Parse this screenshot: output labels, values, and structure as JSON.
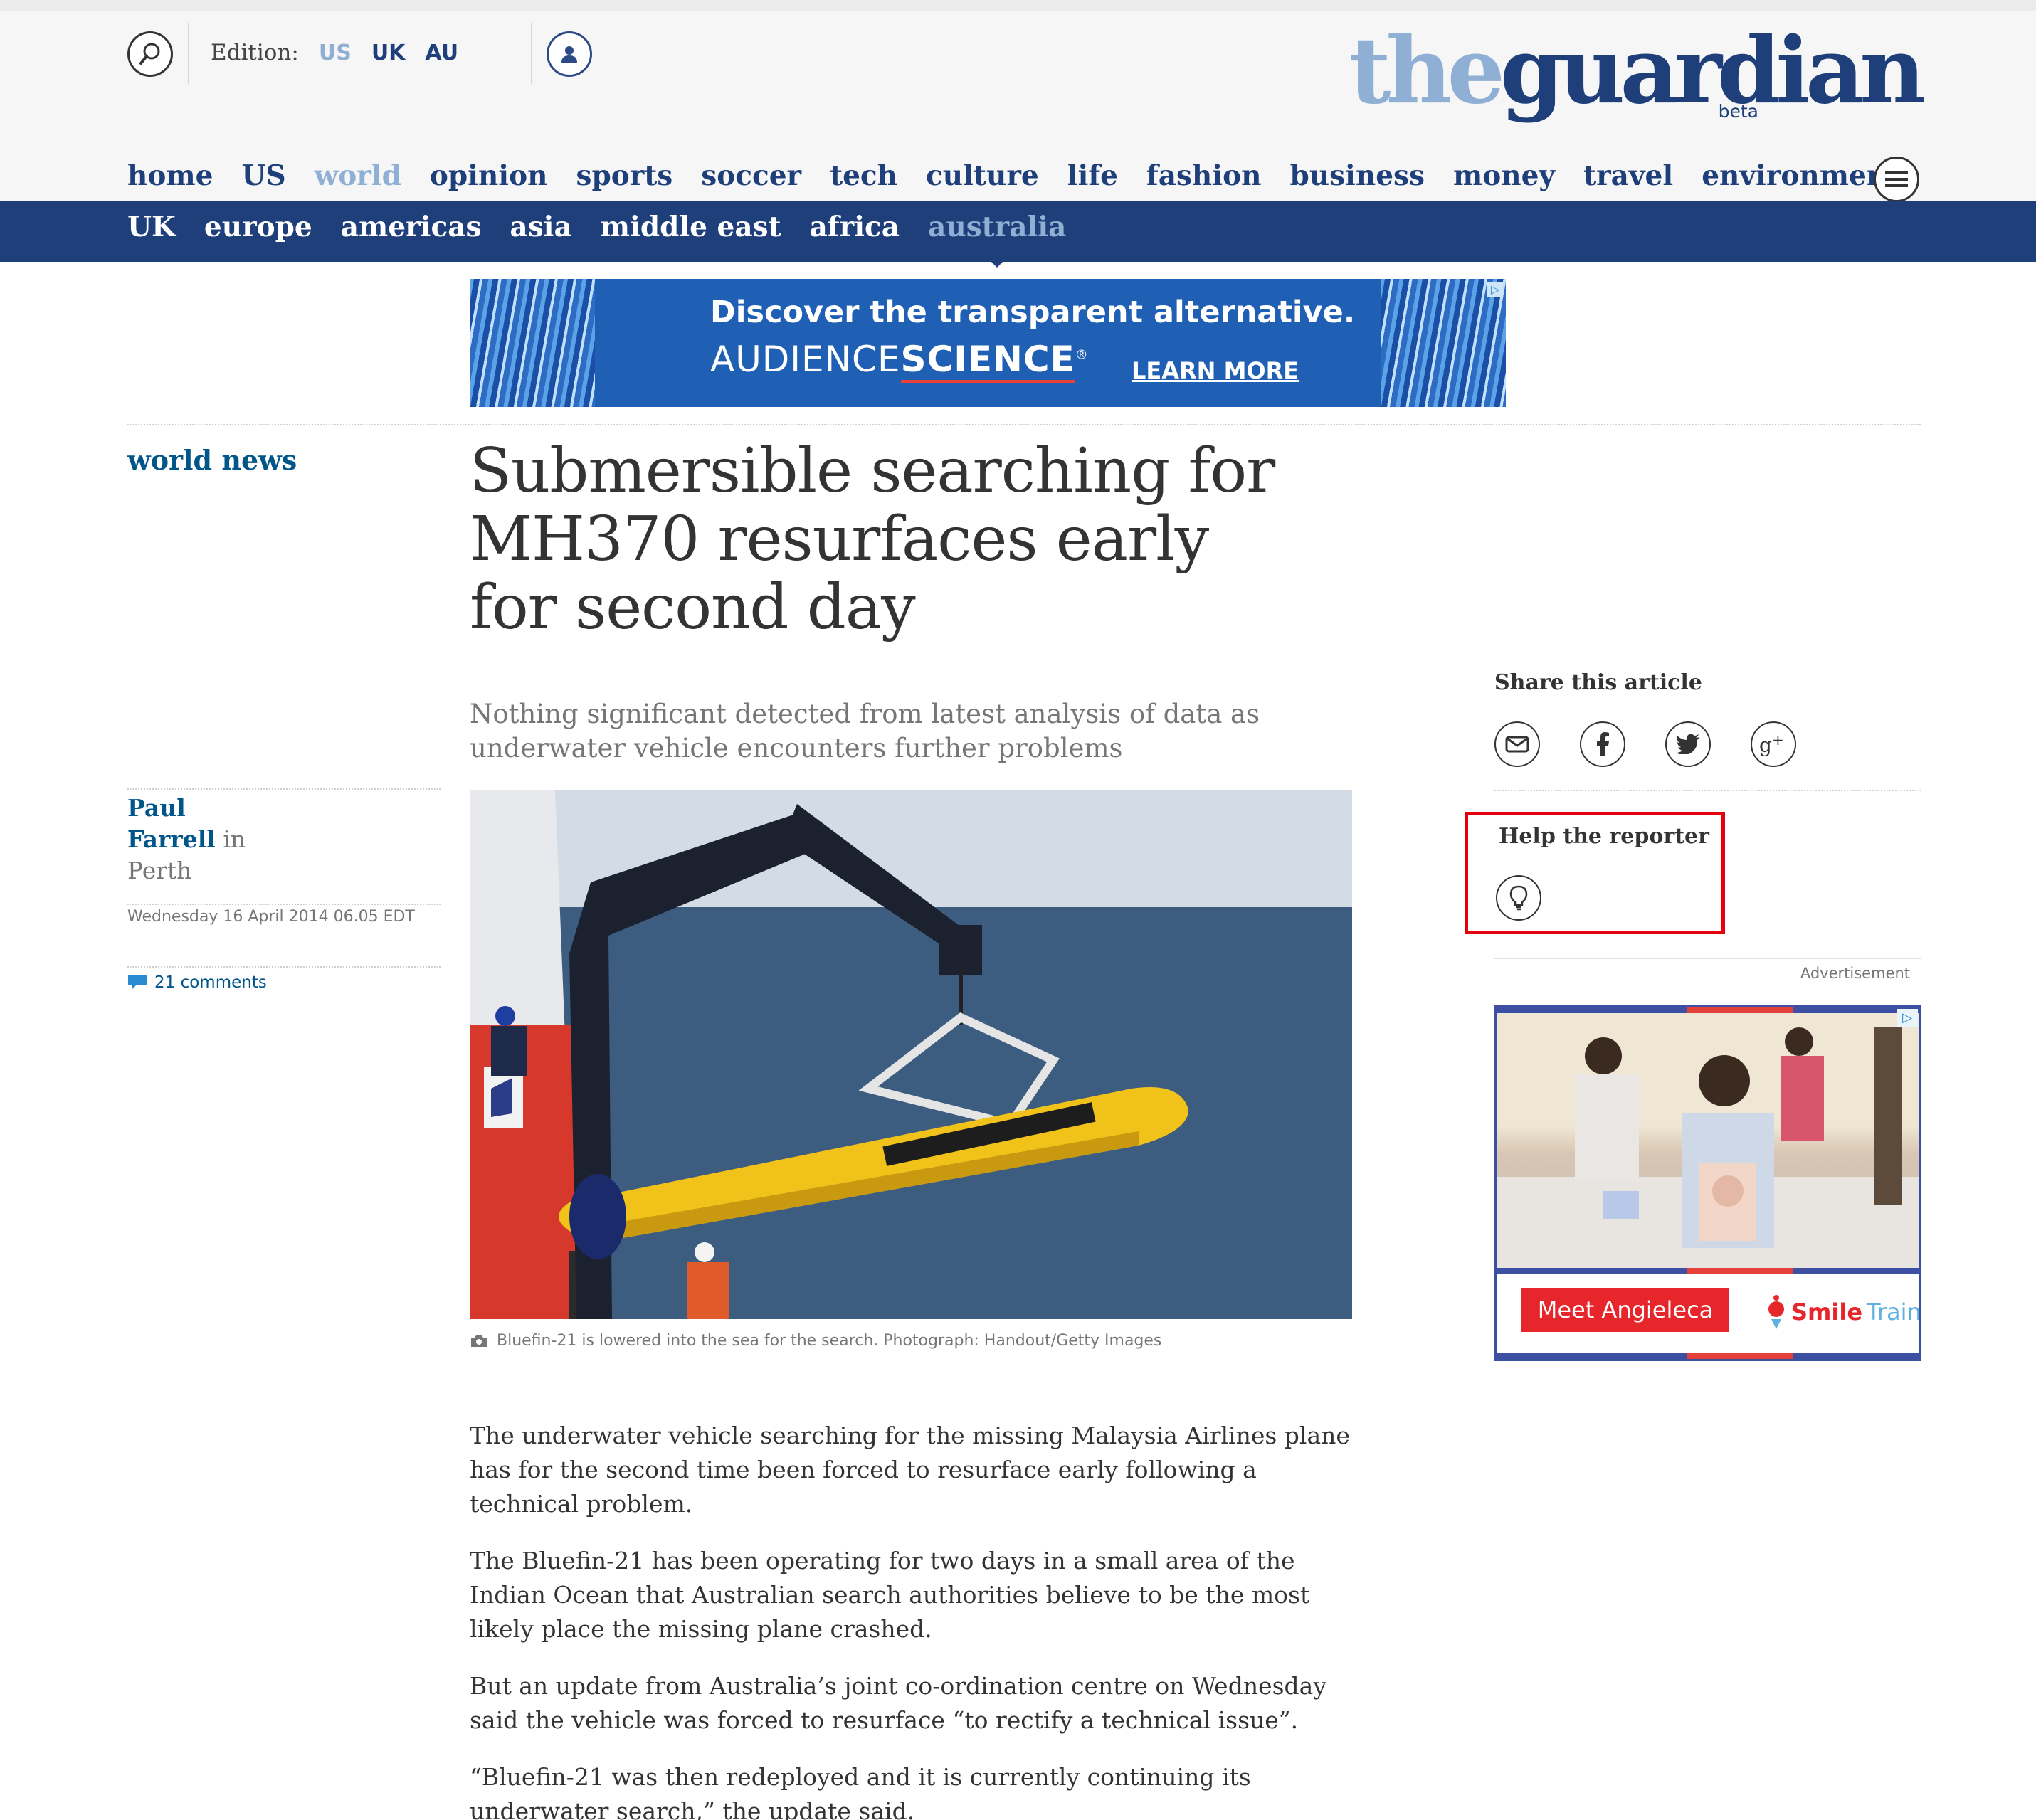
{
  "header": {
    "edition_label": "Edition:",
    "editions": [
      {
        "label": "US",
        "active": true
      },
      {
        "label": "UK",
        "active": false
      },
      {
        "label": "AU",
        "active": false
      }
    ],
    "logo_the": "the",
    "logo_guardian": "guardian",
    "logo_beta": "beta",
    "icons": [
      "search-icon",
      "profile-icon",
      "menu-icon"
    ]
  },
  "nav": {
    "items": [
      {
        "label": "home",
        "active": false
      },
      {
        "label": "US",
        "active": false
      },
      {
        "label": "world",
        "active": true
      },
      {
        "label": "opinion",
        "active": false
      },
      {
        "label": "sports",
        "active": false
      },
      {
        "label": "soccer",
        "active": false
      },
      {
        "label": "tech",
        "active": false
      },
      {
        "label": "culture",
        "active": false
      },
      {
        "label": "life",
        "active": false
      },
      {
        "label": "fashion",
        "active": false
      },
      {
        "label": "business",
        "active": false
      },
      {
        "label": "money",
        "active": false
      },
      {
        "label": "travel",
        "active": false
      },
      {
        "label": "environment",
        "active": false
      }
    ]
  },
  "subnav": {
    "items": [
      {
        "label": "UK",
        "active": false
      },
      {
        "label": "europe",
        "active": false
      },
      {
        "label": "americas",
        "active": false
      },
      {
        "label": "asia",
        "active": false
      },
      {
        "label": "middle east",
        "active": false
      },
      {
        "label": "africa",
        "active": false
      },
      {
        "label": "australia",
        "active": true
      }
    ]
  },
  "banner_ad": {
    "headline": "Discover the transparent alternative.",
    "brand_a": "AUDIENCE",
    "brand_b": "SCIENCE",
    "brand_mark": "®",
    "cta": "LEARN MORE"
  },
  "article": {
    "section": "world news",
    "headline": "Submersible searching for MH370 resurfaces early for second day",
    "standfirst": "Nothing significant detected from latest analysis of data as underwater vehicle encounters further problems",
    "author_first": "Paul",
    "author_last": "Farrell",
    "in": " in",
    "location": "Perth",
    "date": "Wednesday 16 April 2014 06.05 EDT",
    "comments": "21 comments",
    "caption": "Bluefin-21 is lowered into the sea for the search. Photograph: Handout/Getty Images",
    "paragraphs": [
      "The underwater vehicle searching for the missing Malaysia Airlines plane has for the second time been forced to resurface early following a technical problem.",
      "The Bluefin-21 has been operating for two days in a small area of the Indian Ocean that Australian search authorities believe to be the most likely place the missing plane crashed.",
      "But an update from Australia’s joint co-ordination centre on Wednesday said the vehicle was forced to resurface “to rectify a technical issue”.",
      "“Bluefin-21 was then redeployed and it is currently continuing its underwater search,” the update said."
    ]
  },
  "sidebar": {
    "share_title": "Share this article",
    "share_icons": [
      "email-icon",
      "facebook-icon",
      "twitter-icon",
      "google-plus-icon"
    ],
    "help_title": "Help the reporter",
    "help_icon": "lightbulb-icon",
    "advert_label": "Advertisement",
    "ad_cta": "Meet Angieleca",
    "ad_brand_a": "Smile",
    "ad_brand_b": "Train"
  },
  "colors": {
    "brand_dark": "#1e3f7a",
    "brand_light": "#8fb0d4",
    "link": "#005689",
    "highlight_border": "#e6000e"
  }
}
